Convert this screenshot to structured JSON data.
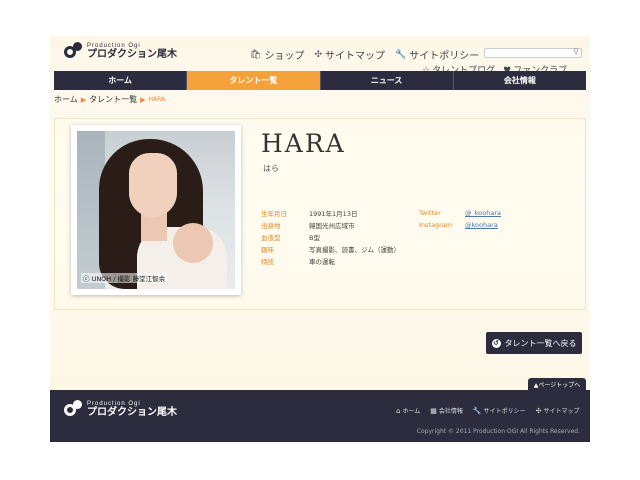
{
  "logo": {
    "en": "Production Ogi",
    "jp": "プロダクション尾木"
  },
  "header": {
    "links": [
      {
        "icon": "shop-icon",
        "glyph": "🛍",
        "label": "ショップ"
      },
      {
        "icon": "sitemap-icon",
        "glyph": "✣",
        "label": "サイトマップ"
      },
      {
        "icon": "policy-icon",
        "glyph": "🔧",
        "label": "サイトポリシー"
      }
    ],
    "sublinks": [
      {
        "icon": "blog-icon",
        "glyph": "☆",
        "label": "タレントブログ"
      },
      {
        "icon": "fanclub-icon",
        "glyph": "♥",
        "label": "ファンクラブ"
      }
    ],
    "search": {
      "placeholder": ""
    }
  },
  "nav": {
    "tabs": [
      {
        "label": "ホーム",
        "active": false
      },
      {
        "label": "タレント一覧",
        "active": true
      },
      {
        "label": "ニュース",
        "active": false
      },
      {
        "label": "会社情報",
        "active": false
      }
    ]
  },
  "breadcrumb": {
    "home": "ホーム",
    "list": "タレント一覧",
    "current": "HARA"
  },
  "profile": {
    "name_en": "HARA",
    "name_jp": "はら",
    "photo_credit": "ⓒ UNOH / 撮影 藤堂江智余",
    "info": [
      {
        "k": "生年月日",
        "v": "1991年1月13日"
      },
      {
        "k": "出身地",
        "v": "韓国光州広域市"
      },
      {
        "k": "血液型",
        "v": "B型"
      },
      {
        "k": "趣味",
        "v": "写真撮影、読書、ジム（運動）"
      },
      {
        "k": "特技",
        "v": "車の運転"
      }
    ],
    "sns": [
      {
        "k": "Twitter",
        "v": "@_koohara"
      },
      {
        "k": "Instagram",
        "v": "@koohara"
      }
    ]
  },
  "back_button": {
    "label": "タレント一覧へ戻る"
  },
  "pagetop": {
    "label": "▲ページトップへ"
  },
  "footer": {
    "links": [
      {
        "glyph": "⌂",
        "label": "ホーム"
      },
      {
        "glyph": "▦",
        "label": "会社情報"
      },
      {
        "glyph": "🔧",
        "label": "サイトポリシー"
      },
      {
        "glyph": "✣",
        "label": "サイトマップ"
      }
    ],
    "copyright": "Copyright © 2011 Production OGI All Rights Reserved."
  },
  "colors": {
    "accent": "#f5a13a",
    "nav": "#2c2c3e",
    "label": "#e48a2a",
    "link": "#4a7ab0"
  }
}
